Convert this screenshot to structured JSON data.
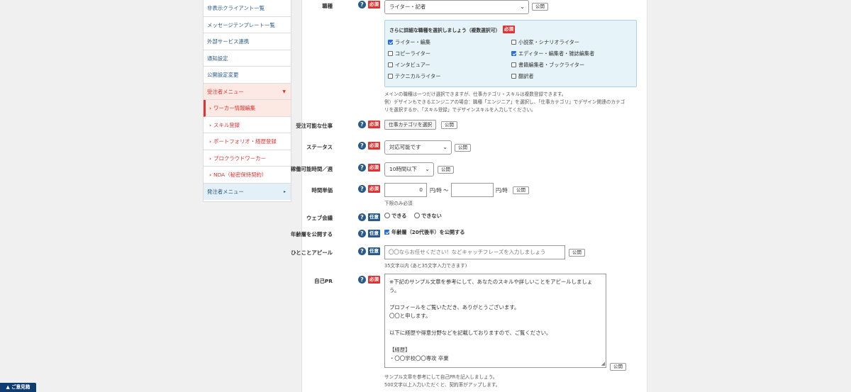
{
  "sidebar": {
    "items": [
      {
        "label": "非表示クライアント一覧"
      },
      {
        "label": "メッセージテンプレート一覧"
      },
      {
        "label": "外部サービス連携"
      },
      {
        "label": "通知設定"
      },
      {
        "label": "公開設定変更"
      }
    ],
    "receiver_menu": {
      "label": "受注者メニュー",
      "arrow": "▼"
    },
    "sub_items": [
      {
        "label": "ワーカー情報編集",
        "chev": "›"
      },
      {
        "label": "スキル登録",
        "chev": "›"
      },
      {
        "label": "ポートフォリオ・経歴登録",
        "chev": "›"
      },
      {
        "label": "プロクラウドワーカー",
        "chev": "›"
      },
      {
        "label": "NDA（秘密保持契約）",
        "chev": "›"
      }
    ],
    "sender_menu": {
      "label": "発注者メニュー",
      "arrow": "▸"
    }
  },
  "badges": {
    "required": "必須",
    "optional": "任意",
    "help": "?",
    "public": "公開"
  },
  "form": {
    "role": {
      "label": "職種",
      "value": "ライター・記者",
      "caret": "⌄"
    },
    "subrole": {
      "title": "さらに詳細な職種を選択しましょう（複数選択可）",
      "options": [
        {
          "label": "ライター・編集",
          "checked": true
        },
        {
          "label": "小説家・シナリオライター",
          "checked": false
        },
        {
          "label": "コピーライター",
          "checked": false
        },
        {
          "label": "エディター・編集者・雑誌編集者",
          "checked": true
        },
        {
          "label": "インタビュアー",
          "checked": false
        },
        {
          "label": "書籍編集者・ブックライター",
          "checked": false
        },
        {
          "label": "テクニカルライター",
          "checked": false
        },
        {
          "label": "翻訳者",
          "checked": false
        }
      ],
      "notes": [
        "メインの職種は一つだけ選択できますが、仕事カテゴリ・スキルは複数登録できます。",
        "例）デザインもできるエンジニアの場合：職種「エンジニア」を選択し、「仕事カテゴリ」でデザイン関連のカテゴ",
        "リを選択するか、「スキル登録」でデザインスキルを入力してください。"
      ]
    },
    "work": {
      "label": "受注可能な仕事",
      "button": "仕事カテゴリを選択"
    },
    "status": {
      "label": "ステータス",
      "value": "対応可能です",
      "caret": "⌄"
    },
    "hours": {
      "label": "稼働可能時間／週",
      "value": "10時間以下",
      "caret": "⌄"
    },
    "rate": {
      "label": "時間単価",
      "min_value": "0",
      "unit_from": "円/時 〜",
      "max_value": "",
      "unit_to": "円/時",
      "note": "下限のみ必須"
    },
    "web_meeting": {
      "label": "ウェブ会議",
      "options": [
        "できる",
        "できない"
      ]
    },
    "age": {
      "label": "年齢層を公開する",
      "checkbox_label": "年齢層（20代後半）を公開する",
      "checked": true
    },
    "catch": {
      "label": "ひとことアピール",
      "placeholder": "〇〇ならお任せください！などキャッチフレーズを入力しましょう",
      "note": "35文字以内 (あと35文字入力できます)"
    },
    "pr": {
      "label": "自己PR",
      "lines": [
        "※下記のサンプル文章を参考にして、あなたのスキルや詳しいことをアピールしましょ",
        "う。",
        "",
        "プロフィールをご覧いただき、ありがとうございます。",
        "〇〇と申します。",
        "",
        "以下に経歴や得意分野などを記載しておりますので、ご覧ください。",
        "",
        "【経歴】",
        "・〇〇学校〇〇専攻 卒業"
      ],
      "resize_glyph": "◢",
      "notes": [
        "サンプル文章を参考にして自己PRを記入しましょう。",
        "500文字以上入力いただくと、契約率がアップします。"
      ]
    }
  },
  "help_float": {
    "label": "▲ ご意見箱"
  }
}
